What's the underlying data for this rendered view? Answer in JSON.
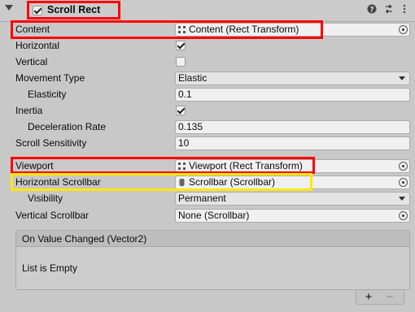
{
  "component": {
    "title": "Scroll Rect",
    "enabled": true,
    "header_icons": [
      "help-icon",
      "presets-icon",
      "more-icon"
    ]
  },
  "rows": {
    "content": {
      "label": "Content",
      "value": "Content (Rect Transform)"
    },
    "horizontal": {
      "label": "Horizontal",
      "checked": true
    },
    "vertical": {
      "label": "Vertical",
      "checked": false
    },
    "movement_type": {
      "label": "Movement Type",
      "value": "Elastic"
    },
    "elasticity": {
      "label": "Elasticity",
      "value": "0.1"
    },
    "inertia": {
      "label": "Inertia",
      "checked": true
    },
    "deceleration_rate": {
      "label": "Deceleration Rate",
      "value": "0.135"
    },
    "scroll_sensitivity": {
      "label": "Scroll Sensitivity",
      "value": "10"
    },
    "viewport": {
      "label": "Viewport",
      "value": "Viewport (Rect Transform)"
    },
    "horizontal_scrollbar": {
      "label": "Horizontal Scrollbar",
      "value": "Scrollbar (Scrollbar)"
    },
    "visibility": {
      "label": "Visibility",
      "value": "Permanent"
    },
    "vertical_scrollbar": {
      "label": "Vertical Scrollbar",
      "value": "None (Scrollbar)"
    }
  },
  "event": {
    "header": "On Value Changed (Vector2)",
    "empty_text": "List is Empty",
    "add_label": "+",
    "remove_label": "−"
  },
  "colors": {
    "highlight_red": "#ff0000",
    "highlight_yellow": "#ffe800"
  }
}
